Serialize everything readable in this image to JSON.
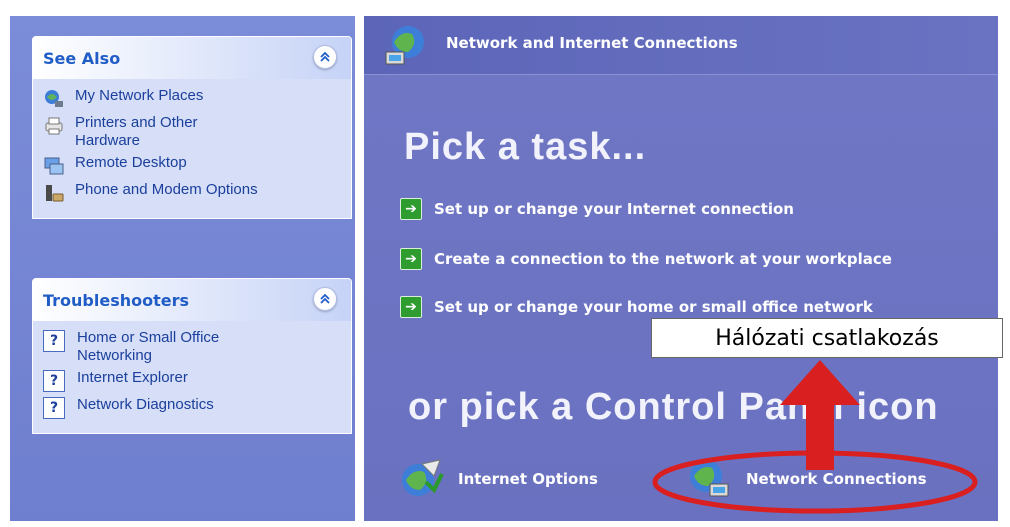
{
  "see_also": {
    "title": "See Also",
    "items": [
      {
        "label": "My Network Places",
        "icon": "network-places-icon"
      },
      {
        "label": "Printers and Other Hardware",
        "icon": "printer-icon"
      },
      {
        "label": "Remote Desktop",
        "icon": "remote-desktop-icon"
      },
      {
        "label": "Phone and Modem Options",
        "icon": "phone-modem-icon"
      }
    ]
  },
  "troubleshooters": {
    "title": "Troubleshooters",
    "items": [
      {
        "label": "Home or Small Office Networking",
        "icon": "help-icon"
      },
      {
        "label": "Internet Explorer",
        "icon": "help-icon"
      },
      {
        "label": "Network Diagnostics",
        "icon": "help-icon"
      }
    ]
  },
  "main": {
    "title": "Network and Internet Connections",
    "pick_task": "Pick a task...",
    "tasks": [
      {
        "label": "Set up or change your Internet connection"
      },
      {
        "label": "Create a connection to the network at your workplace"
      },
      {
        "label": "Set up or change your home or small office network"
      }
    ],
    "or_pick": "or pick a Control Panel icon",
    "icons": [
      {
        "label": "Internet Options",
        "icon": "internet-options-icon"
      },
      {
        "label": "Network Connections",
        "icon": "network-connections-icon"
      }
    ]
  },
  "annotation": {
    "callout": "Hálózati csatlakozás"
  },
  "colors": {
    "left_pane": "#7b8cd8",
    "main_bg": "#6d75c3",
    "link_blue": "#1b3f9c",
    "highlight_red": "#d91f1f",
    "task_arrow_green": "#2f9c2f"
  }
}
